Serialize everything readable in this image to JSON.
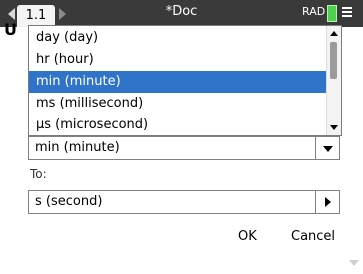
{
  "titlebar": {
    "tab_label": "1.1",
    "doc_title": "*Doc",
    "mode": "RAD"
  },
  "dialog": {
    "title_initial": "U",
    "from_value": "min (minute)",
    "to_label": "To:",
    "to_value": "s (second)",
    "ok_label": "OK",
    "cancel_label": "Cancel"
  },
  "dropdown": {
    "items": [
      {
        "label": "day (day)",
        "selected": false
      },
      {
        "label": "hr (hour)",
        "selected": false
      },
      {
        "label": "min (minute)",
        "selected": true
      },
      {
        "label": "ms (millisecond)",
        "selected": false
      },
      {
        "label": "μs (microsecond)",
        "selected": false
      }
    ]
  },
  "colors": {
    "selection": "#2f74c8",
    "titlebar": "#3a3a3a",
    "battery": "#4fd34f"
  }
}
